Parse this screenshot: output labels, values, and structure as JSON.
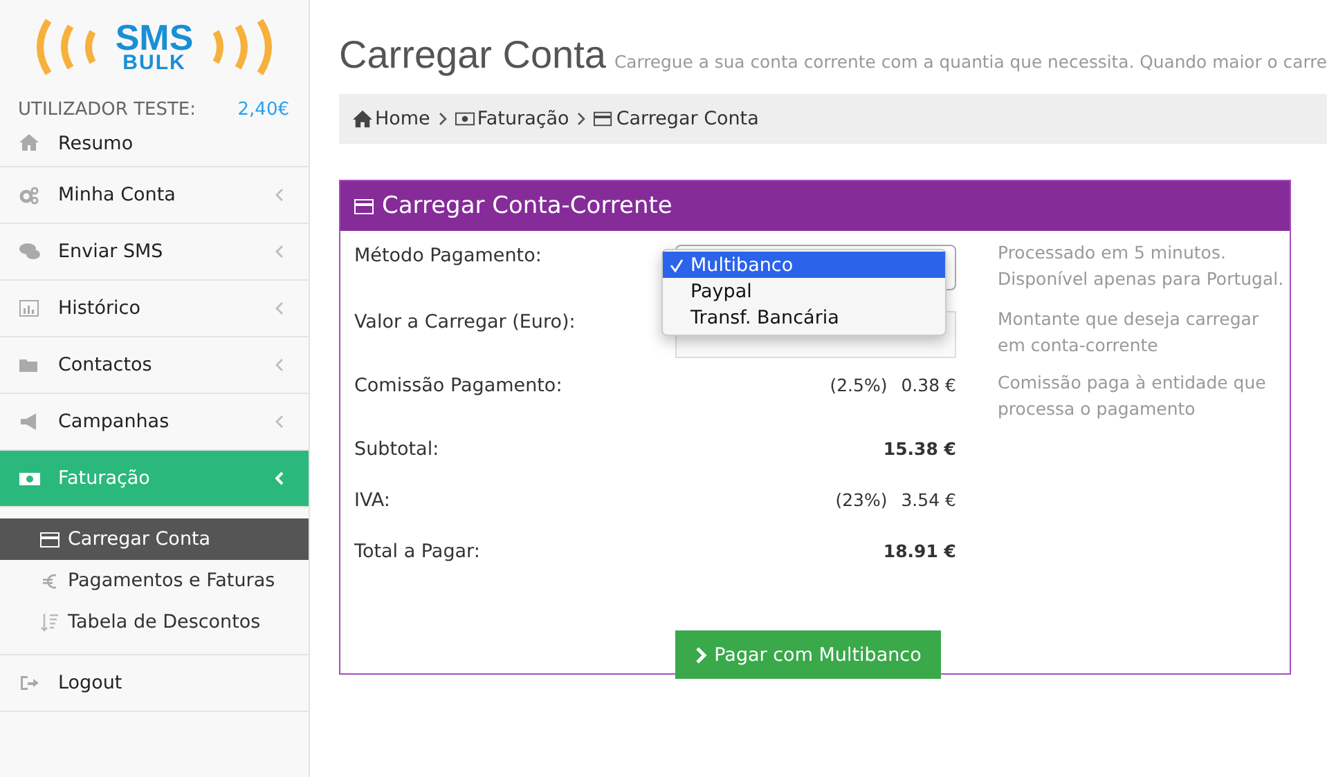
{
  "logo": {
    "line1": "SMS",
    "line2": "BULK"
  },
  "user": {
    "label": "UTILIZADOR TESTE:",
    "balance": "2,40€"
  },
  "sidebar": {
    "items": [
      {
        "label": "Resumo",
        "expandable": false,
        "selected": false
      },
      {
        "label": "Minha Conta",
        "expandable": true,
        "selected": false
      },
      {
        "label": "Enviar SMS",
        "expandable": true,
        "selected": false
      },
      {
        "label": "Histórico",
        "expandable": true,
        "selected": false
      },
      {
        "label": "Contactos",
        "expandable": true,
        "selected": false
      },
      {
        "label": "Campanhas",
        "expandable": true,
        "selected": false
      },
      {
        "label": "Faturação",
        "expandable": true,
        "selected": true,
        "children": [
          {
            "label": "Carregar Conta",
            "selected": true
          },
          {
            "label": "Pagamentos e Faturas",
            "selected": false
          },
          {
            "label": "Tabela de Descontos",
            "selected": false
          }
        ]
      },
      {
        "label": "Logout",
        "expandable": false,
        "selected": false
      }
    ]
  },
  "page": {
    "title": "Carregar Conta",
    "subtitle": "Carregue a sua conta corrente com a quantia que necessita. Quando maior o carre"
  },
  "breadcrumb": [
    "Home",
    "Faturação",
    "Carregar Conta"
  ],
  "panel": {
    "title": "Carregar Conta-Corrente",
    "rows": [
      {
        "kind": "select",
        "label": "Método Pagamento:",
        "help": "Processado em 5 minutos. Disponível apenas para Portugal."
      },
      {
        "kind": "input",
        "label": "Valor a Carregar (Euro):",
        "help": "Montante que deseja carregar em conta-corrente"
      },
      {
        "kind": "amount",
        "label": "Comissão Pagamento:",
        "note": "(2.5%)",
        "value": "0.38 €",
        "help": "Comissão paga à entidade que processa o pagamento"
      },
      {
        "kind": "total",
        "label": "Subtotal:",
        "value": "15.38 €"
      },
      {
        "kind": "amount",
        "label": "IVA:",
        "note": "(23%)",
        "value": "3.54 €"
      },
      {
        "kind": "total",
        "label": "Total a Pagar:",
        "value": "18.91 €"
      }
    ],
    "dropdown": {
      "options": [
        {
          "label": "Multibanco",
          "selected": true
        },
        {
          "label": "Paypal",
          "selected": false
        },
        {
          "label": "Transf. Bancária",
          "selected": false
        }
      ]
    },
    "button": "Pagar com Multibanco"
  }
}
